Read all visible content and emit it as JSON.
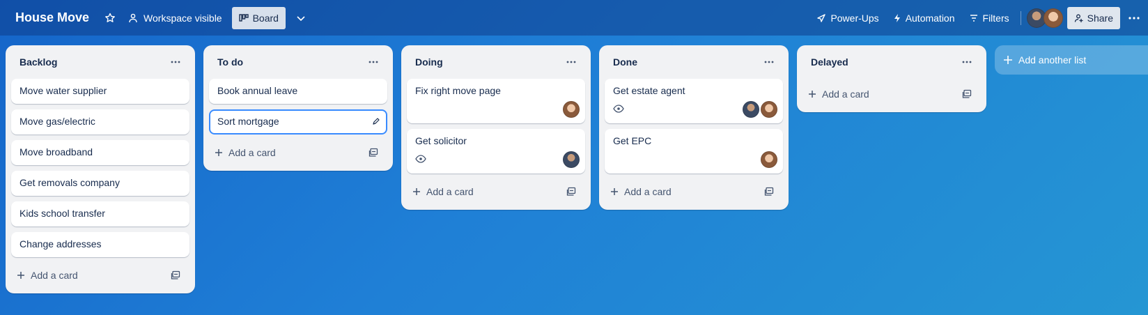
{
  "board": {
    "title": "House Move",
    "visibility_label": "Workspace visible",
    "view_label": "Board"
  },
  "header_right": {
    "powerups_label": "Power-Ups",
    "automation_label": "Automation",
    "filters_label": "Filters",
    "share_label": "Share"
  },
  "lists": [
    {
      "title": "Backlog",
      "cards": [
        "Move water supplier",
        "Move gas/electric",
        "Move broadband",
        "Get removals company",
        "Kids school transfer",
        "Change addresses"
      ],
      "add_label": "Add a card"
    },
    {
      "title": "To do",
      "cards": [
        "Book annual leave",
        "Sort mortgage"
      ],
      "add_label": "Add a card"
    },
    {
      "title": "Doing",
      "cards": [
        "Fix right move page",
        "Get solicitor"
      ],
      "add_label": "Add a card"
    },
    {
      "title": "Done",
      "cards": [
        "Get estate agent",
        "Get EPC"
      ],
      "add_label": "Add a card"
    },
    {
      "title": "Delayed",
      "cards": [],
      "add_label": "Add a card"
    }
  ],
  "add_list_label": "Add another list",
  "icons": {
    "star": "star-icon",
    "visibility": "people-icon",
    "board_view": "board-icon",
    "chevron": "chevron-down-icon",
    "powerups": "rocket-icon",
    "automation": "lightning-icon",
    "filters": "filter-icon",
    "share": "person-add-icon",
    "more": "more-horizontal-icon",
    "watch": "eye-icon",
    "edit": "pencil-icon",
    "template": "card-template-icon",
    "add": "plus-icon"
  },
  "colors": {
    "accent": "#388bff",
    "list_bg": "#f1f2f4",
    "header_bg": "#1c4f9c"
  }
}
